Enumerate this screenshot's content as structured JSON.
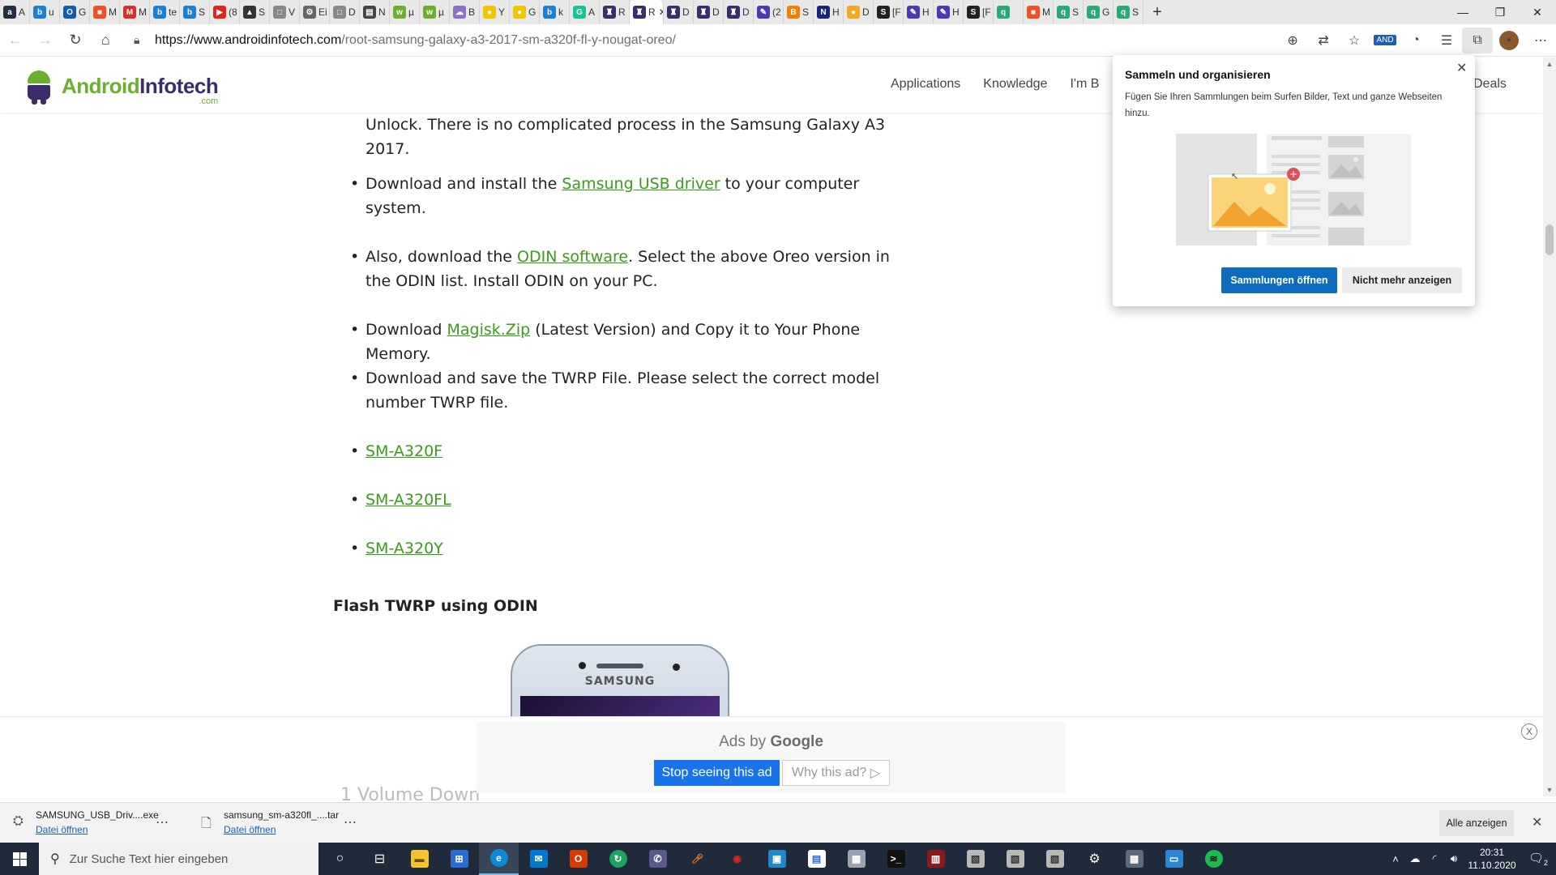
{
  "browser": {
    "tabs": [
      {
        "label": "A",
        "icon": "amazon-icon",
        "color": "#232f3e",
        "glyph": "a"
      },
      {
        "label": "u",
        "icon": "bing-icon",
        "color": "#1b7fd6",
        "glyph": "b"
      },
      {
        "label": "G",
        "icon": "outlook-icon",
        "color": "#0f5fb0",
        "glyph": "O"
      },
      {
        "label": "M",
        "icon": "microsoft-icon",
        "color": "#f25022",
        "glyph": "■"
      },
      {
        "label": "M",
        "icon": "gmail-icon",
        "color": "#d93025",
        "glyph": "M"
      },
      {
        "label": "te",
        "icon": "bing-icon",
        "color": "#1b7fd6",
        "glyph": "b"
      },
      {
        "label": "S",
        "icon": "bing-icon",
        "color": "#1b7fd6",
        "glyph": "b"
      },
      {
        "label": "(8",
        "icon": "youtube-icon",
        "color": "#e62117",
        "glyph": "▶"
      },
      {
        "label": "S",
        "icon": "profile-icon",
        "color": "#333333",
        "glyph": "▲"
      },
      {
        "label": "V",
        "icon": "page-icon",
        "color": "#888888",
        "glyph": "□"
      },
      {
        "label": "Ei",
        "icon": "settings-icon",
        "color": "#666666",
        "glyph": "⚙"
      },
      {
        "label": "D",
        "icon": "page-icon",
        "color": "#888888",
        "glyph": "□"
      },
      {
        "label": "N",
        "icon": "screen-icon",
        "color": "#444444",
        "glyph": "▤"
      },
      {
        "label": "µ",
        "icon": "w-icon",
        "color": "#6cae2e",
        "glyph": "w"
      },
      {
        "label": "µ",
        "icon": "w-icon",
        "color": "#6cae2e",
        "glyph": "w"
      },
      {
        "label": "B",
        "icon": "cloud-icon",
        "color": "#8b6fc9",
        "glyph": "☁"
      },
      {
        "label": "Y",
        "icon": "norton-icon",
        "color": "#f5c400",
        "glyph": "●"
      },
      {
        "label": "G",
        "icon": "norton-icon",
        "color": "#f5c400",
        "glyph": "●"
      },
      {
        "label": "k",
        "icon": "bing-icon",
        "color": "#1b7fd6",
        "glyph": "b"
      },
      {
        "label": "A",
        "icon": "grammarly-icon",
        "color": "#15c39a",
        "glyph": "G"
      },
      {
        "label": "R",
        "icon": "android-icon",
        "color": "#3b2c6b",
        "glyph": "♜"
      },
      {
        "label": "R",
        "icon": "android-icon",
        "color": "#3b2c6b",
        "glyph": "♜",
        "active": true
      },
      {
        "label": "D",
        "icon": "android-icon",
        "color": "#3b2c6b",
        "glyph": "♜"
      },
      {
        "label": "D",
        "icon": "android-icon",
        "color": "#3b2c6b",
        "glyph": "♜"
      },
      {
        "label": "D",
        "icon": "android-icon",
        "color": "#3b2c6b",
        "glyph": "♜"
      },
      {
        "label": "(2",
        "icon": "feather-icon",
        "color": "#4a3ab5",
        "glyph": "✎"
      },
      {
        "label": "S",
        "icon": "blogger-icon",
        "color": "#f57d00",
        "glyph": "B"
      },
      {
        "label": "H",
        "icon": "app-icon",
        "color": "#1a237e",
        "glyph": "N"
      },
      {
        "label": "D",
        "icon": "circle-icon",
        "color": "#f5a623",
        "glyph": "●"
      },
      {
        "label": "[F",
        "icon": "s-icon",
        "color": "#222222",
        "glyph": "S"
      },
      {
        "label": "H",
        "icon": "feather-icon",
        "color": "#4a3ab5",
        "glyph": "✎"
      },
      {
        "label": "H",
        "icon": "feather-icon",
        "color": "#4a3ab5",
        "glyph": "✎"
      },
      {
        "label": "[F",
        "icon": "s-icon",
        "color": "#222222",
        "glyph": "S"
      },
      {
        "label": "",
        "icon": "search-green-icon",
        "color": "#2aa876",
        "glyph": "q"
      },
      {
        "label": "M",
        "icon": "microsoft-icon",
        "color": "#f25022",
        "glyph": "■"
      },
      {
        "label": "S",
        "icon": "search-green-icon",
        "color": "#2aa876",
        "glyph": "q"
      },
      {
        "label": "G",
        "icon": "search-green-icon",
        "color": "#2aa876",
        "glyph": "q"
      },
      {
        "label": "S",
        "icon": "search-green-icon",
        "color": "#2aa876",
        "glyph": "q"
      }
    ],
    "new_tab": "+",
    "url_host": "https://www.androidinfotech.com",
    "url_path": "/root-samsung-galaxy-a3-2017-sm-a320f-fl-y-nougat-oreo/"
  },
  "site": {
    "logo_part1": "Android",
    "logo_part2": "Infotech",
    "logo_suffix": ".com",
    "menu": [
      "Applications",
      "Knowledge",
      "I'm B"
    ],
    "menu_end": "Deals"
  },
  "article": {
    "para_top_1": "Unlock. There is no complicated process in the Samsung Galaxy A3",
    "para_top_2": "2017.",
    "b1_pre": "Download and install the ",
    "b1_link": "Samsung USB driver",
    "b1_post": " to your computer",
    "b1_line2": "system.",
    "b2_pre": "Also, download the ",
    "b2_link": "ODIN software",
    "b2_post": ". Select the above Oreo version in",
    "b2_line2": "the ODIN list. Install ODIN on your PC.",
    "b3_pre": "Download ",
    "b3_link": "Magisk.Zip",
    "b3_post": " (Latest Version) and Copy it to Your Phone",
    "b3_line2": "Memory.",
    "b4_line1": "Download and save the TWRP File. Please select the correct model",
    "b4_line2": "number TWRP file.",
    "models": [
      "SM-A320F",
      "SM-A320FL",
      "SM-A320Y"
    ],
    "heading": "Flash TWRP using ODIN",
    "phone_brand": "SAMSUNG",
    "behind_text": "1 Volume Down"
  },
  "ad": {
    "ads_by": "Ads by",
    "google": "Google",
    "stop": "Stop seeing this ad",
    "why": "Why this ad?",
    "close": "X"
  },
  "popup": {
    "title": "Sammeln und organisieren",
    "description": "Fügen Sie Ihren Sammlungen beim Surfen Bilder, Text und ganze Webseiten hinzu.",
    "open_button": "Sammlungen öffnen",
    "dismiss_button": "Nicht mehr anzeigen"
  },
  "downloads": {
    "items": [
      {
        "name": "SAMSUNG_USB_Driv....exe",
        "action": "Datei öffnen"
      },
      {
        "name": "samsung_sm-a320fl_....tar",
        "action": "Datei öffnen"
      }
    ],
    "show_all": "Alle anzeigen"
  },
  "taskbar": {
    "search_placeholder": "Zur Suche Text hier eingeben",
    "time": "20:31",
    "date": "11.10.2020",
    "notifications": "2"
  },
  "colors": {
    "link": "#3d9a1a",
    "popup_primary": "#0f6cbd",
    "ad_button": "#1a73e8",
    "taskbar": "#1f2a3a"
  }
}
